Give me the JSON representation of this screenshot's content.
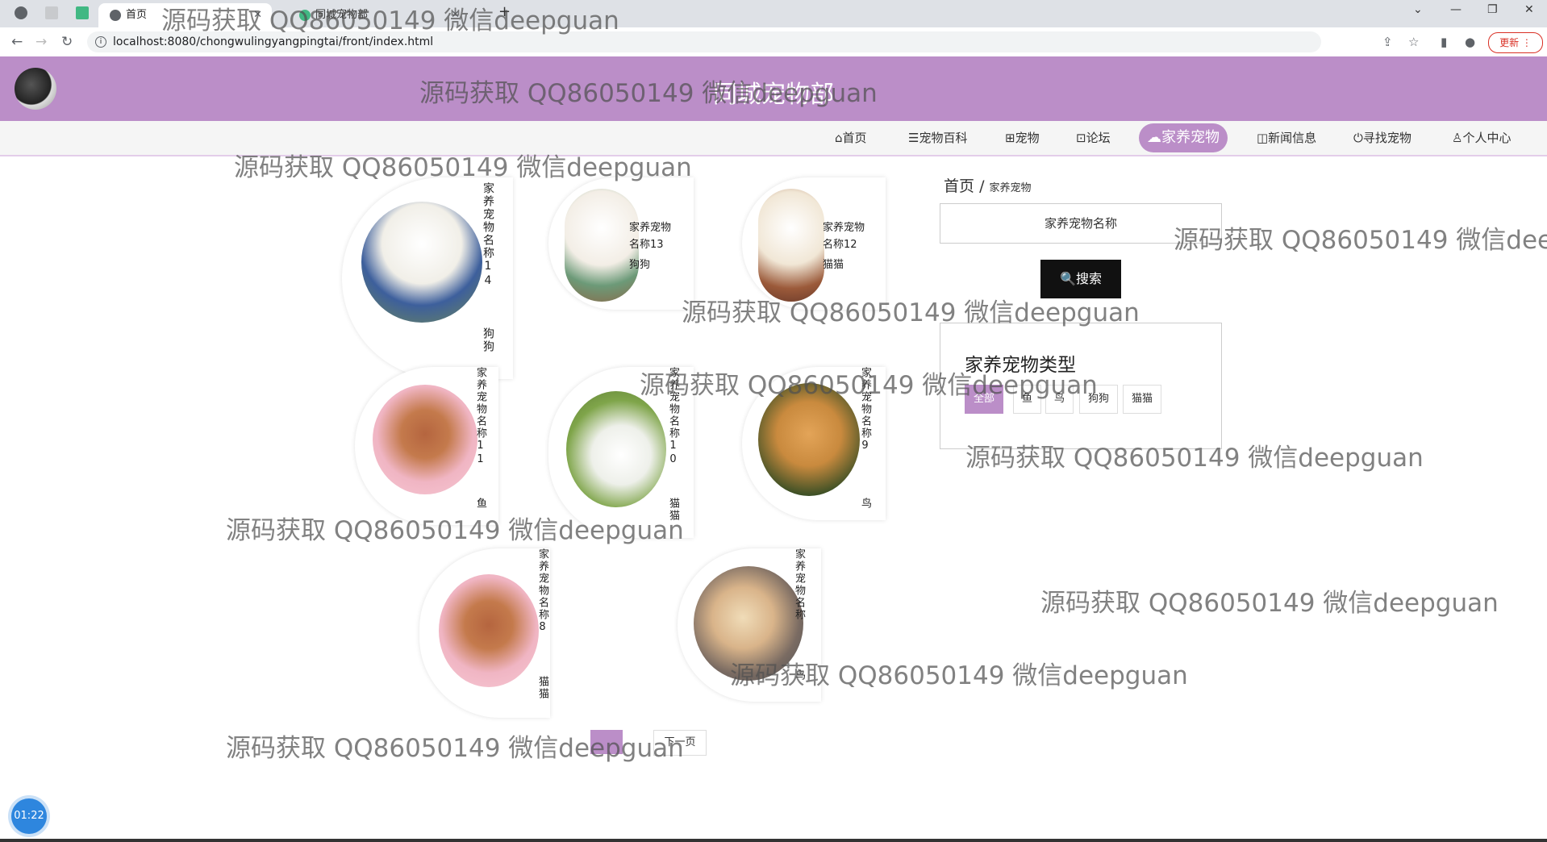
{
  "browser": {
    "tabs": [
      {
        "label": "首页"
      },
      {
        "label": "同城宠物部"
      }
    ],
    "url": "localhost:8080/chongwulingyangpingtai/front/index.html",
    "update_label": "更新"
  },
  "site": {
    "title": "同城宠物部"
  },
  "nav": [
    {
      "label": "⌂首页"
    },
    {
      "label": "☰宠物百科"
    },
    {
      "label": "⊞宠物"
    },
    {
      "label": "⊡论坛"
    },
    {
      "label": "☁家养宠物"
    },
    {
      "label": "◫新闻信息"
    },
    {
      "label": "⏻寻找宠物"
    },
    {
      "label": "♙个人中心"
    }
  ],
  "pets": [
    {
      "name": "家养宠物名称14",
      "type": "狗狗"
    },
    {
      "name": "家养宠物名称13",
      "type": "狗狗"
    },
    {
      "name": "家养宠物名称12",
      "type": "猫猫"
    },
    {
      "name": "家养宠物名称11",
      "type": "鱼"
    },
    {
      "name": "家养宠物名称10",
      "type": "猫猫"
    },
    {
      "name": "家养宠物名称9",
      "type": "鸟"
    },
    {
      "name": "家养宠物名称8",
      "type": "猫猫"
    },
    {
      "name": "家养宠物名称",
      "type": "鸟"
    }
  ],
  "breadcrumb": {
    "home": "首页",
    "separator": "/",
    "current": "家养宠物"
  },
  "search": {
    "placeholder": "家养宠物名称",
    "button_label": "🔍搜索"
  },
  "type_filter": {
    "title": "家养宠物类型",
    "options": [
      "全部",
      "鱼",
      "鸟",
      "狗狗",
      "猫猫"
    ],
    "selected": "全部"
  },
  "pagination": {
    "next_label": "下一页"
  },
  "timer": "01:22",
  "watermark": "源码获取 QQ86050149 微信deepguan",
  "colors": {
    "accent": "#bb8ec8",
    "search_button": "#111111"
  }
}
